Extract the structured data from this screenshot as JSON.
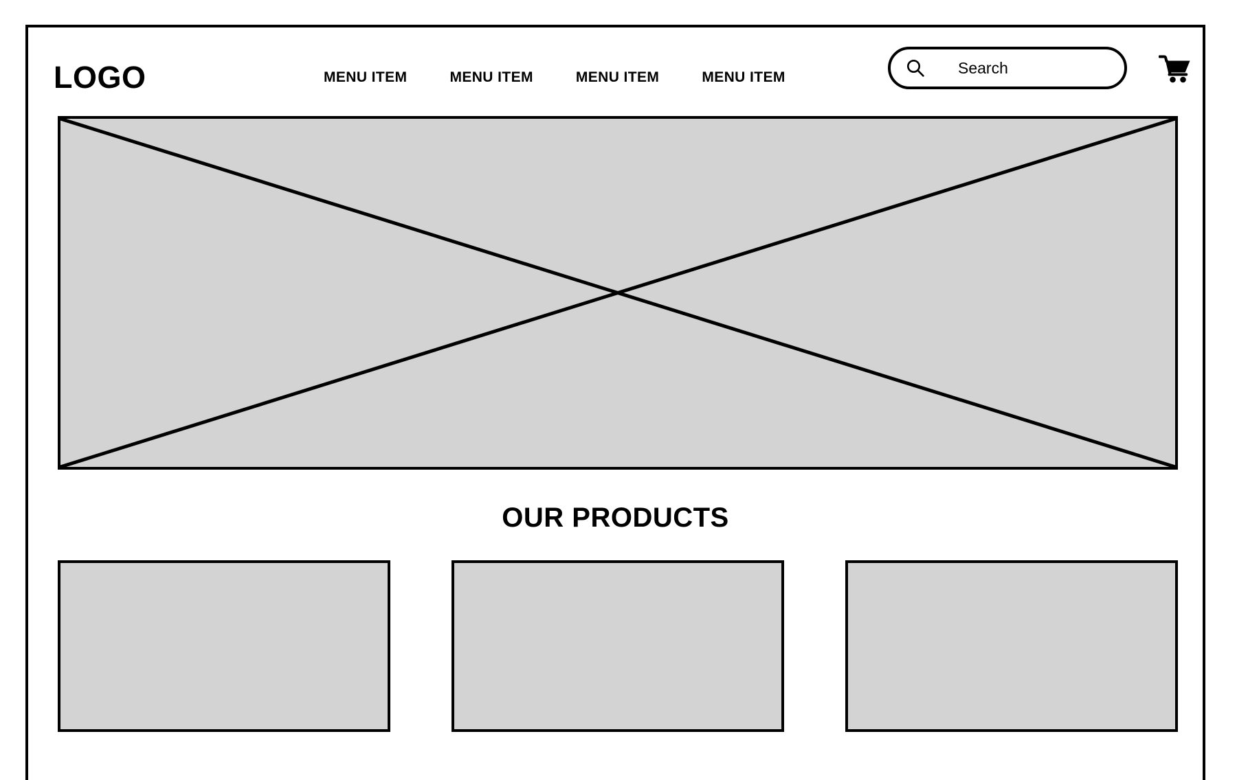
{
  "page": {
    "type": "wireframe-mockup",
    "title": "E-commerce Homepage Wireframe",
    "colors": {
      "placeholder_fill": "#d3d3d3",
      "stroke": "#000000",
      "background": "#ffffff"
    }
  },
  "header": {
    "logo": "LOGO",
    "nav_items": [
      {
        "label": "MENU ITEM"
      },
      {
        "label": "MENU ITEM"
      },
      {
        "label": "MENU ITEM"
      },
      {
        "label": "MENU ITEM"
      }
    ],
    "search": {
      "icon": "search-icon",
      "placeholder": "Search",
      "value": ""
    },
    "cart": {
      "icon": "shopping-cart-icon"
    }
  },
  "hero": {
    "type": "image-placeholder",
    "icon": "crossed-box-placeholder"
  },
  "products": {
    "heading": "OUR PRODUCTS",
    "cards": [
      {
        "label": ""
      },
      {
        "label": ""
      },
      {
        "label": ""
      }
    ]
  }
}
